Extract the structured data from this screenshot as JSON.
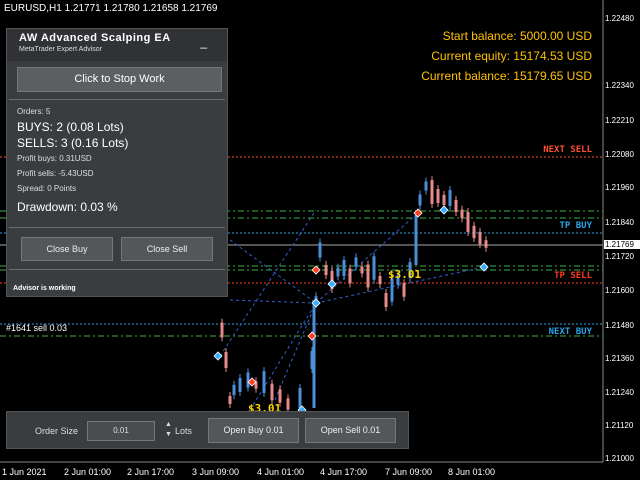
{
  "symbol": "EURUSD,H1  1.21771 1.21780 1.21658 1.21769",
  "balances": {
    "start": "Start balance: 5000.00 USD",
    "equity": "Current equity: 15174.53 USD",
    "current": "Current balance: 15179.65 USD"
  },
  "levels": {
    "next_sell": "NEXT SELL",
    "tp_buy": "TP BUY",
    "tp_sell": "TP SELL",
    "next_buy": "NEXT BUY"
  },
  "price_scale": [
    "1.22480",
    "1.22340",
    "1.22210",
    "1.22080",
    "1.21960",
    "1.21840",
    "1.21769",
    "1.21720",
    "1.21600",
    "1.21480",
    "1.21360",
    "1.21240",
    "1.21120",
    "1.21000"
  ],
  "time_scale": [
    "1 Jun 2021",
    "2 Jun 01:00",
    "2 Jun 17:00",
    "3 Jun 09:00",
    "4 Jun 01:00",
    "4 Jun 17:00",
    "7 Jun 09:00",
    "8 Jun 01:00"
  ],
  "trade_annotation": "#1641 sell 0.03",
  "profit_labels": [
    "$3.01",
    "$3.01"
  ],
  "panel": {
    "title": "AW Advanced Scalping EA",
    "subtitle": "MetaTrader Expert Advisor",
    "minimize": "_",
    "stop_button": "Click to Stop Work",
    "orders": "Orders: 5",
    "buys": "BUYS: 2 (0.08 Lots)",
    "sells": "SELLS: 3 (0.16 Lots)",
    "profit_buys": "Profit buys: 0.31USD",
    "profit_sells": "Profit sells: -5.43USD",
    "spread": "Spread: 0 Points",
    "drawdown": "Drawdown: 0.03 %",
    "close_buy": "Close Buy",
    "close_sell": "Close Sell",
    "status": "Advisor is working"
  },
  "order_bar": {
    "size_label": "Order Size",
    "size_value": "0.01",
    "lots_label": "Lots",
    "open_buy": "Open Buy 0.01",
    "open_sell": "Open Sell 0.01"
  },
  "colors": {
    "background": "#000000",
    "bull_candle": "#4a90d9",
    "bear_candle": "#e88a8a",
    "tp_buy": "#2aa3e8",
    "tp_sell": "#ff3b1f",
    "next_sell": "#ff5030",
    "next_buy": "#2aa3e8",
    "balance_text": "#ffc107",
    "profit_label": "#ffd400",
    "grid_green": "#3cb043"
  }
}
